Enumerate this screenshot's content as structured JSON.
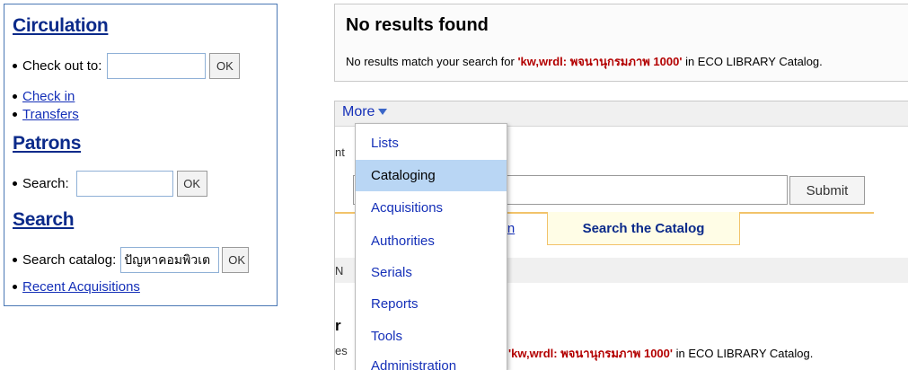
{
  "left": {
    "circulation": {
      "title": "Circulation",
      "checkout_label": "Check out to:",
      "checkout_value": "",
      "ok": "OK",
      "links": [
        "Check in",
        "Transfers"
      ]
    },
    "patrons": {
      "title": "Patrons",
      "search_label": "Search:",
      "search_value": "",
      "ok": "OK"
    },
    "search": {
      "title": "Search",
      "catalog_label": "Search catalog:",
      "catalog_value": "ปัญหาคอมพิวเต",
      "ok": "OK",
      "recent_link": "Recent Acquisitions"
    }
  },
  "no_results": {
    "title": "No results found",
    "message_prefix": "No results match your search for ",
    "query": "'kw,wrdl: พจนานุกรมภาพ 1000'",
    "message_suffix": " in ECO LIBRARY Catalog."
  },
  "nav": {
    "more_label": "More",
    "submit_label": "Submit",
    "tab_checkin_fragment": "k In",
    "tab_search": "Search the Catalog",
    "fragments": {
      "a": "nt",
      "b": "N",
      "c": "r",
      "d": "es"
    },
    "bottom_query": "'kw,wrdl: พจนานุกรมภาพ 1000'",
    "bottom_suffix": " in ECO LIBRARY Catalog."
  },
  "dropdown": {
    "items": [
      "Lists",
      "Cataloging",
      "Acquisitions",
      "Authorities",
      "Serials",
      "Reports",
      "Tools",
      "Administration"
    ],
    "active": "Cataloging"
  },
  "colors": {
    "link": "#1530b8",
    "heading": "#0b2a8a",
    "highlight": "#b9d6f4",
    "query": "#b30000",
    "tab_border": "#f2c36a"
  }
}
